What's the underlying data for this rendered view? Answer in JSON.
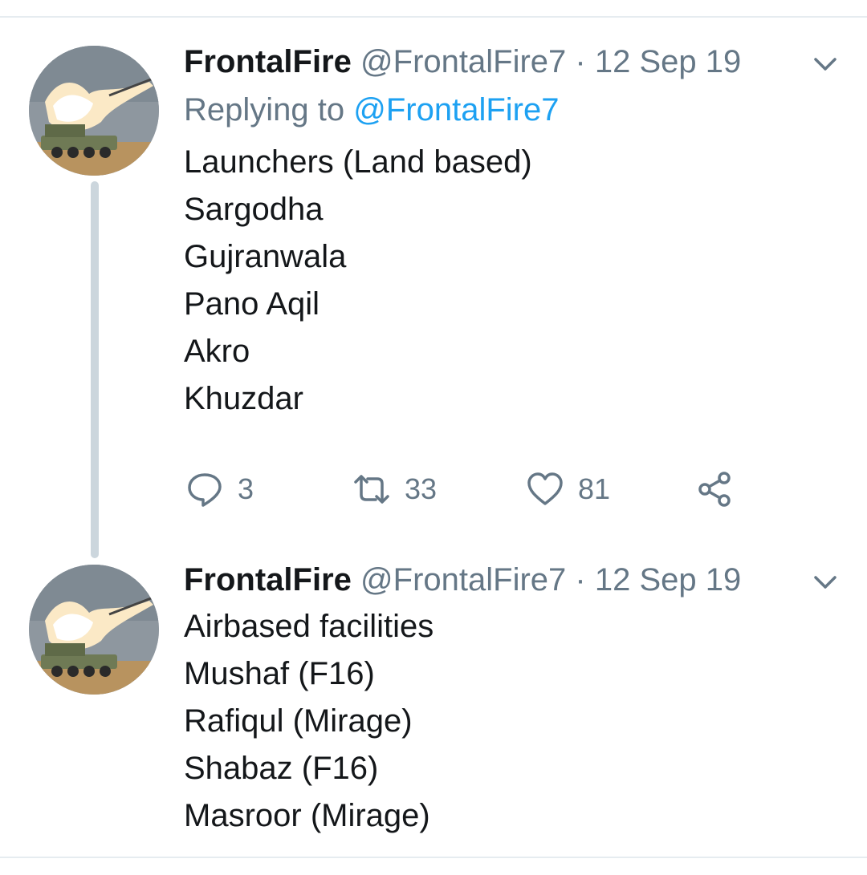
{
  "tweets": [
    {
      "name": "FrontalFire",
      "handle": "@FrontalFire7",
      "separator": "·",
      "date": "12 Sep 19",
      "replying_prefix": "Replying to",
      "replying_to": "@FrontalFire7",
      "lines": [
        "Launchers (Land based)",
        "Sargodha",
        "Gujranwala",
        "Pano Aqil",
        "Akro",
        "Khuzdar"
      ],
      "actions": {
        "replies": "3",
        "retweets": "33",
        "likes": "81"
      }
    },
    {
      "name": "FrontalFire",
      "handle": "@FrontalFire7",
      "separator": "·",
      "date": "12 Sep 19",
      "lines": [
        "Airbased facilities",
        "Mushaf (F16)",
        "Rafiqul (Mirage)",
        "Shabaz (F16)",
        "Masroor (Mirage)"
      ]
    }
  ],
  "icons": {
    "avatar": "rocket-launch-avatar",
    "caret": "chevron-down-icon",
    "reply": "reply-icon",
    "retweet": "retweet-icon",
    "like": "heart-icon",
    "share": "share-icon"
  },
  "colors": {
    "text": "#14171a",
    "secondary": "#657786",
    "link": "#1da1f2",
    "thread_line": "#ccd6dd",
    "divider": "#e6ecf0"
  }
}
